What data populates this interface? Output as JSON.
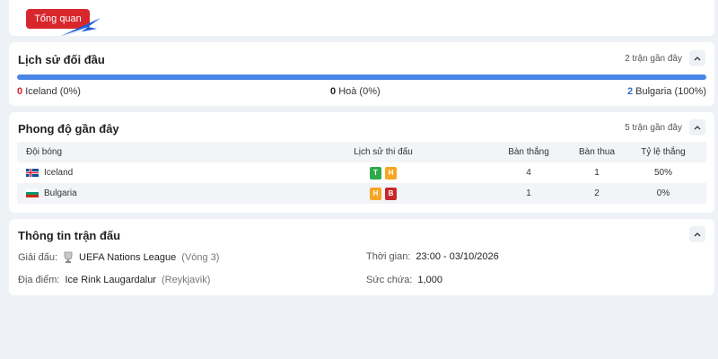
{
  "top": {
    "tab_label": "Tổng quan"
  },
  "h2h": {
    "title": "Lịch sử đối đầu",
    "recent": "2 trận gần đây",
    "home": {
      "count": "0",
      "label": "Iceland (0%)"
    },
    "draw": {
      "count": "0",
      "label": "Hoà (0%)"
    },
    "away": {
      "count": "2",
      "label": "Bulgaria (100%)"
    }
  },
  "form": {
    "title": "Phong độ gần đây",
    "recent": "5 trận gần đây",
    "headers": {
      "team": "Đội bóng",
      "history": "Lịch sử thi đấu",
      "wins": "Bàn thắng",
      "losses": "Bàn thua",
      "rate": "Tỷ lệ thắng"
    },
    "rows": [
      {
        "team": "Iceland",
        "results": [
          "T",
          "H"
        ],
        "wins": "4",
        "losses": "1",
        "rate": "50%"
      },
      {
        "team": "Bulgaria",
        "results": [
          "H",
          "B"
        ],
        "wins": "1",
        "losses": "2",
        "rate": "0%"
      }
    ]
  },
  "info": {
    "title": "Thông tin trận đấu",
    "league_label": "Giải đấu:",
    "league": "UEFA Nations League",
    "round": "(Vòng 3)",
    "venue_label": "Địa điểm:",
    "venue": "Ice Rink Laugardalur",
    "city": "(Reykjavik)",
    "time_label": "Thời gian:",
    "time": "23:00 - 03/10/2026",
    "capacity_label": "Sức chứa:",
    "capacity": "1,000"
  },
  "colors": {
    "accent_red": "#d8262d",
    "bar_blue": "#4a86e8",
    "win_green": "#2eaa4a",
    "draw_orange": "#f5a623",
    "loss_red": "#c62828"
  }
}
